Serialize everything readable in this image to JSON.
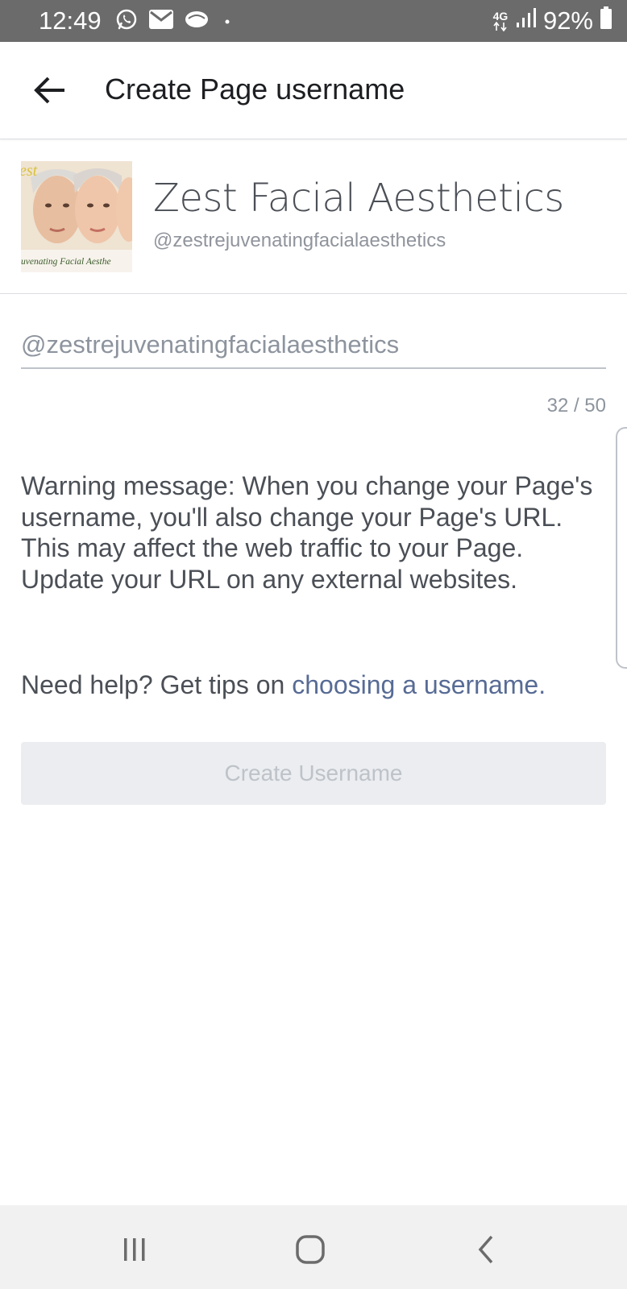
{
  "status_bar": {
    "time": "12:49",
    "network": "4G",
    "battery": "92%",
    "icons": [
      "whatsapp-icon",
      "gmail-icon",
      "message-icon",
      "dot-icon",
      "signal-icon",
      "battery-icon"
    ]
  },
  "header": {
    "title": "Create Page username",
    "back_icon": "arrow-left-icon"
  },
  "page": {
    "name": "Zest Facial Aesthetics",
    "handle": "@zestrejuvenatingfacialaesthetics",
    "avatar_caption_top": "est",
    "avatar_caption_bottom": "uvenating Facial Aesthe"
  },
  "form": {
    "username_value": "@zestrejuvenatingfacialaesthetics",
    "counter": "32 / 50",
    "warning": "Warning message: When you change your Page's username, you'll also change your Page's URL. This may affect the web traffic to your Page. Update your URL on any external websites.",
    "help_prefix": "Need help? Get tips on ",
    "help_link": "choosing a username.",
    "submit_label": "Create Username"
  },
  "nav": {
    "icons": [
      "recent-apps-icon",
      "home-icon",
      "back-icon"
    ]
  },
  "colors": {
    "link": "#576b95",
    "status_bar": "#6b6b6b",
    "button_disabled_bg": "#ebedf0",
    "button_disabled_text": "#bec3c9"
  }
}
